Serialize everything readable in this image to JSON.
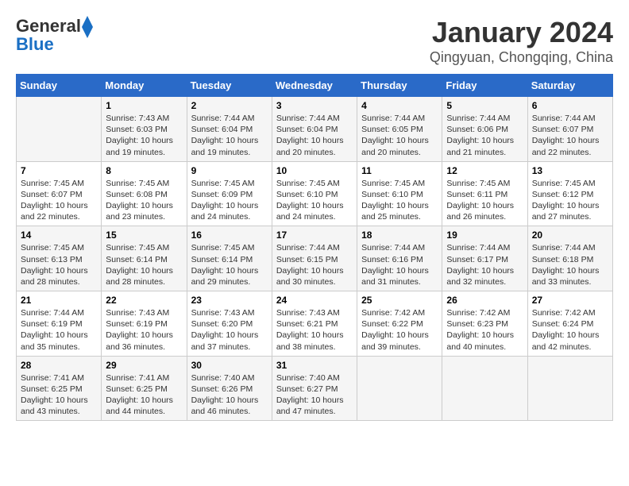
{
  "logo": {
    "line1": "General",
    "line2": "Blue"
  },
  "title": "January 2024",
  "subtitle": "Qingyuan, Chongqing, China",
  "days_header": [
    "Sunday",
    "Monday",
    "Tuesday",
    "Wednesday",
    "Thursday",
    "Friday",
    "Saturday"
  ],
  "weeks": [
    [
      {
        "day": "",
        "info": ""
      },
      {
        "day": "1",
        "info": "Sunrise: 7:43 AM\nSunset: 6:03 PM\nDaylight: 10 hours and 19 minutes."
      },
      {
        "day": "2",
        "info": "Sunrise: 7:44 AM\nSunset: 6:04 PM\nDaylight: 10 hours and 19 minutes."
      },
      {
        "day": "3",
        "info": "Sunrise: 7:44 AM\nSunset: 6:04 PM\nDaylight: 10 hours and 20 minutes."
      },
      {
        "day": "4",
        "info": "Sunrise: 7:44 AM\nSunset: 6:05 PM\nDaylight: 10 hours and 20 minutes."
      },
      {
        "day": "5",
        "info": "Sunrise: 7:44 AM\nSunset: 6:06 PM\nDaylight: 10 hours and 21 minutes."
      },
      {
        "day": "6",
        "info": "Sunrise: 7:44 AM\nSunset: 6:07 PM\nDaylight: 10 hours and 22 minutes."
      }
    ],
    [
      {
        "day": "7",
        "info": "Sunrise: 7:45 AM\nSunset: 6:07 PM\nDaylight: 10 hours and 22 minutes."
      },
      {
        "day": "8",
        "info": "Sunrise: 7:45 AM\nSunset: 6:08 PM\nDaylight: 10 hours and 23 minutes."
      },
      {
        "day": "9",
        "info": "Sunrise: 7:45 AM\nSunset: 6:09 PM\nDaylight: 10 hours and 24 minutes."
      },
      {
        "day": "10",
        "info": "Sunrise: 7:45 AM\nSunset: 6:10 PM\nDaylight: 10 hours and 24 minutes."
      },
      {
        "day": "11",
        "info": "Sunrise: 7:45 AM\nSunset: 6:10 PM\nDaylight: 10 hours and 25 minutes."
      },
      {
        "day": "12",
        "info": "Sunrise: 7:45 AM\nSunset: 6:11 PM\nDaylight: 10 hours and 26 minutes."
      },
      {
        "day": "13",
        "info": "Sunrise: 7:45 AM\nSunset: 6:12 PM\nDaylight: 10 hours and 27 minutes."
      }
    ],
    [
      {
        "day": "14",
        "info": "Sunrise: 7:45 AM\nSunset: 6:13 PM\nDaylight: 10 hours and 28 minutes."
      },
      {
        "day": "15",
        "info": "Sunrise: 7:45 AM\nSunset: 6:14 PM\nDaylight: 10 hours and 28 minutes."
      },
      {
        "day": "16",
        "info": "Sunrise: 7:45 AM\nSunset: 6:14 PM\nDaylight: 10 hours and 29 minutes."
      },
      {
        "day": "17",
        "info": "Sunrise: 7:44 AM\nSunset: 6:15 PM\nDaylight: 10 hours and 30 minutes."
      },
      {
        "day": "18",
        "info": "Sunrise: 7:44 AM\nSunset: 6:16 PM\nDaylight: 10 hours and 31 minutes."
      },
      {
        "day": "19",
        "info": "Sunrise: 7:44 AM\nSunset: 6:17 PM\nDaylight: 10 hours and 32 minutes."
      },
      {
        "day": "20",
        "info": "Sunrise: 7:44 AM\nSunset: 6:18 PM\nDaylight: 10 hours and 33 minutes."
      }
    ],
    [
      {
        "day": "21",
        "info": "Sunrise: 7:44 AM\nSunset: 6:19 PM\nDaylight: 10 hours and 35 minutes."
      },
      {
        "day": "22",
        "info": "Sunrise: 7:43 AM\nSunset: 6:19 PM\nDaylight: 10 hours and 36 minutes."
      },
      {
        "day": "23",
        "info": "Sunrise: 7:43 AM\nSunset: 6:20 PM\nDaylight: 10 hours and 37 minutes."
      },
      {
        "day": "24",
        "info": "Sunrise: 7:43 AM\nSunset: 6:21 PM\nDaylight: 10 hours and 38 minutes."
      },
      {
        "day": "25",
        "info": "Sunrise: 7:42 AM\nSunset: 6:22 PM\nDaylight: 10 hours and 39 minutes."
      },
      {
        "day": "26",
        "info": "Sunrise: 7:42 AM\nSunset: 6:23 PM\nDaylight: 10 hours and 40 minutes."
      },
      {
        "day": "27",
        "info": "Sunrise: 7:42 AM\nSunset: 6:24 PM\nDaylight: 10 hours and 42 minutes."
      }
    ],
    [
      {
        "day": "28",
        "info": "Sunrise: 7:41 AM\nSunset: 6:25 PM\nDaylight: 10 hours and 43 minutes."
      },
      {
        "day": "29",
        "info": "Sunrise: 7:41 AM\nSunset: 6:25 PM\nDaylight: 10 hours and 44 minutes."
      },
      {
        "day": "30",
        "info": "Sunrise: 7:40 AM\nSunset: 6:26 PM\nDaylight: 10 hours and 46 minutes."
      },
      {
        "day": "31",
        "info": "Sunrise: 7:40 AM\nSunset: 6:27 PM\nDaylight: 10 hours and 47 minutes."
      },
      {
        "day": "",
        "info": ""
      },
      {
        "day": "",
        "info": ""
      },
      {
        "day": "",
        "info": ""
      }
    ]
  ]
}
